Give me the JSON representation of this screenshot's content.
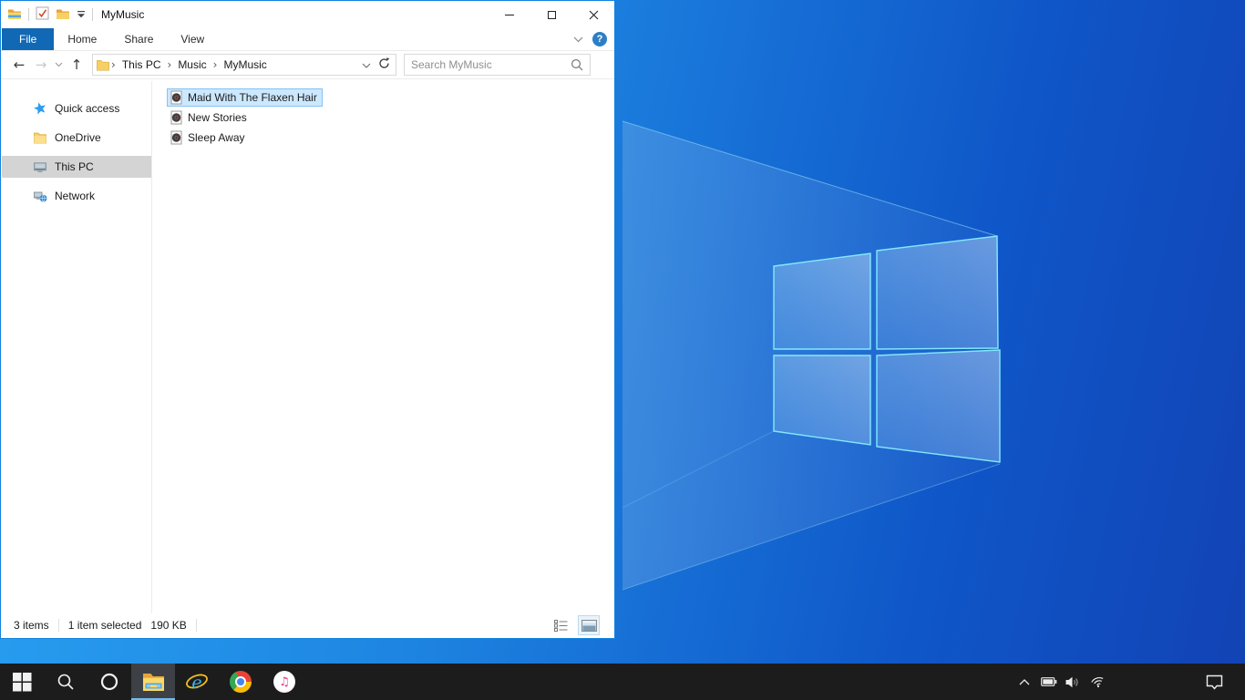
{
  "colors": {
    "accent_border": "#1283dd",
    "file_tab_blue": "#1168b4",
    "selection_fill": "#cce8ff",
    "selection_border": "#84c3f1",
    "sidebar_selected": "#d4d4d4",
    "taskbar_bg": "#1c1c1c",
    "taskbar_active_underline": "#76b9ed",
    "wallpaper_light": "#2aa3f3",
    "wallpaper_dark": "#1243b5"
  },
  "titlebar": {
    "title": "MyMusic",
    "qat_icons": [
      "file-explorer-icon",
      "properties-check-icon",
      "new-folder-icon",
      "customize-quick-access-dropdown"
    ],
    "window_controls": [
      "minimize",
      "maximize",
      "close"
    ]
  },
  "ribbon": {
    "tabs": [
      {
        "label": "File",
        "active": true
      },
      {
        "label": "Home",
        "active": false
      },
      {
        "label": "Share",
        "active": false
      },
      {
        "label": "View",
        "active": false
      }
    ],
    "right_icons": [
      "expand-ribbon-chevron",
      "help"
    ],
    "help_glyph": "?"
  },
  "navbar": {
    "nav_icons": [
      "back-arrow",
      "forward-arrow",
      "recent-locations-chevron",
      "up-arrow"
    ],
    "back_glyph": "←",
    "forward_glyph": "→",
    "up_glyph": "↑",
    "breadcrumb": [
      "This PC",
      "Music",
      "MyMusic"
    ],
    "crumb_sep": "›",
    "search_placeholder": "Search MyMusic"
  },
  "sidebar": {
    "items": [
      {
        "label": "Quick access",
        "icon": "quick-access-star",
        "selected": false
      },
      {
        "label": "OneDrive",
        "icon": "onedrive-folder",
        "selected": false
      },
      {
        "label": "This PC",
        "icon": "this-pc-monitor",
        "selected": true
      },
      {
        "label": "Network",
        "icon": "network-computers",
        "selected": false
      }
    ]
  },
  "files": {
    "items": [
      {
        "name": "Maid With The Flaxen Hair",
        "icon": "music-file",
        "selected": true
      },
      {
        "name": "New Stories",
        "icon": "music-file",
        "selected": false
      },
      {
        "name": "Sleep Away",
        "icon": "music-file",
        "selected": false
      }
    ]
  },
  "statusbar": {
    "items_count": "3 items",
    "selection_count": "1 item selected",
    "selection_size": "190 KB",
    "view_icons": [
      "details-view",
      "large-icons-view"
    ]
  },
  "taskbar": {
    "buttons": [
      {
        "name": "start",
        "active": false
      },
      {
        "name": "search",
        "active": false
      },
      {
        "name": "cortana",
        "active": false
      },
      {
        "name": "file-explorer",
        "active": true
      },
      {
        "name": "internet-explorer",
        "active": false
      },
      {
        "name": "chrome",
        "active": false
      },
      {
        "name": "itunes",
        "active": false
      }
    ],
    "itunes_glyph": "♫",
    "tray_icons": [
      "show-hidden-icons-chevron",
      "battery",
      "volume",
      "wifi"
    ],
    "action_center_icon": "action-center"
  }
}
